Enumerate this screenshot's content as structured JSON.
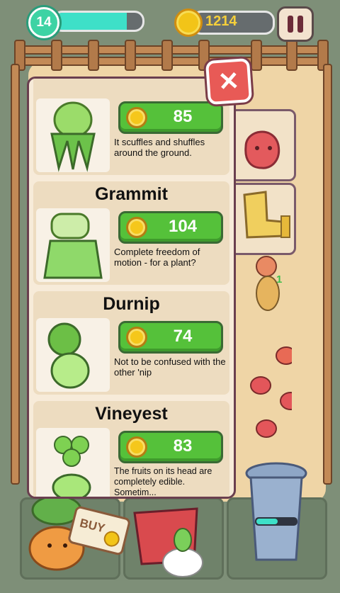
{
  "hud": {
    "level": "14",
    "xp_progress": 0.82,
    "coins": "1214",
    "pause_icon": "pause-icon"
  },
  "shop": {
    "close_icon": "close-icon",
    "items": [
      {
        "name": "",
        "price": "85",
        "description": "It scuffles and shuffles around the ground."
      },
      {
        "name": "Grammit",
        "price": "104",
        "description": "Complete freedom of motion - for a plant?"
      },
      {
        "name": "Durnip",
        "price": "74",
        "description": "Not to be confused with the other 'nip"
      },
      {
        "name": "Vineyest",
        "price": "83",
        "description": "The fruits on its head are completely edible. Sometim..."
      }
    ]
  },
  "scene": {
    "buy_sign": "BUY",
    "plant_count_badge": "1"
  }
}
